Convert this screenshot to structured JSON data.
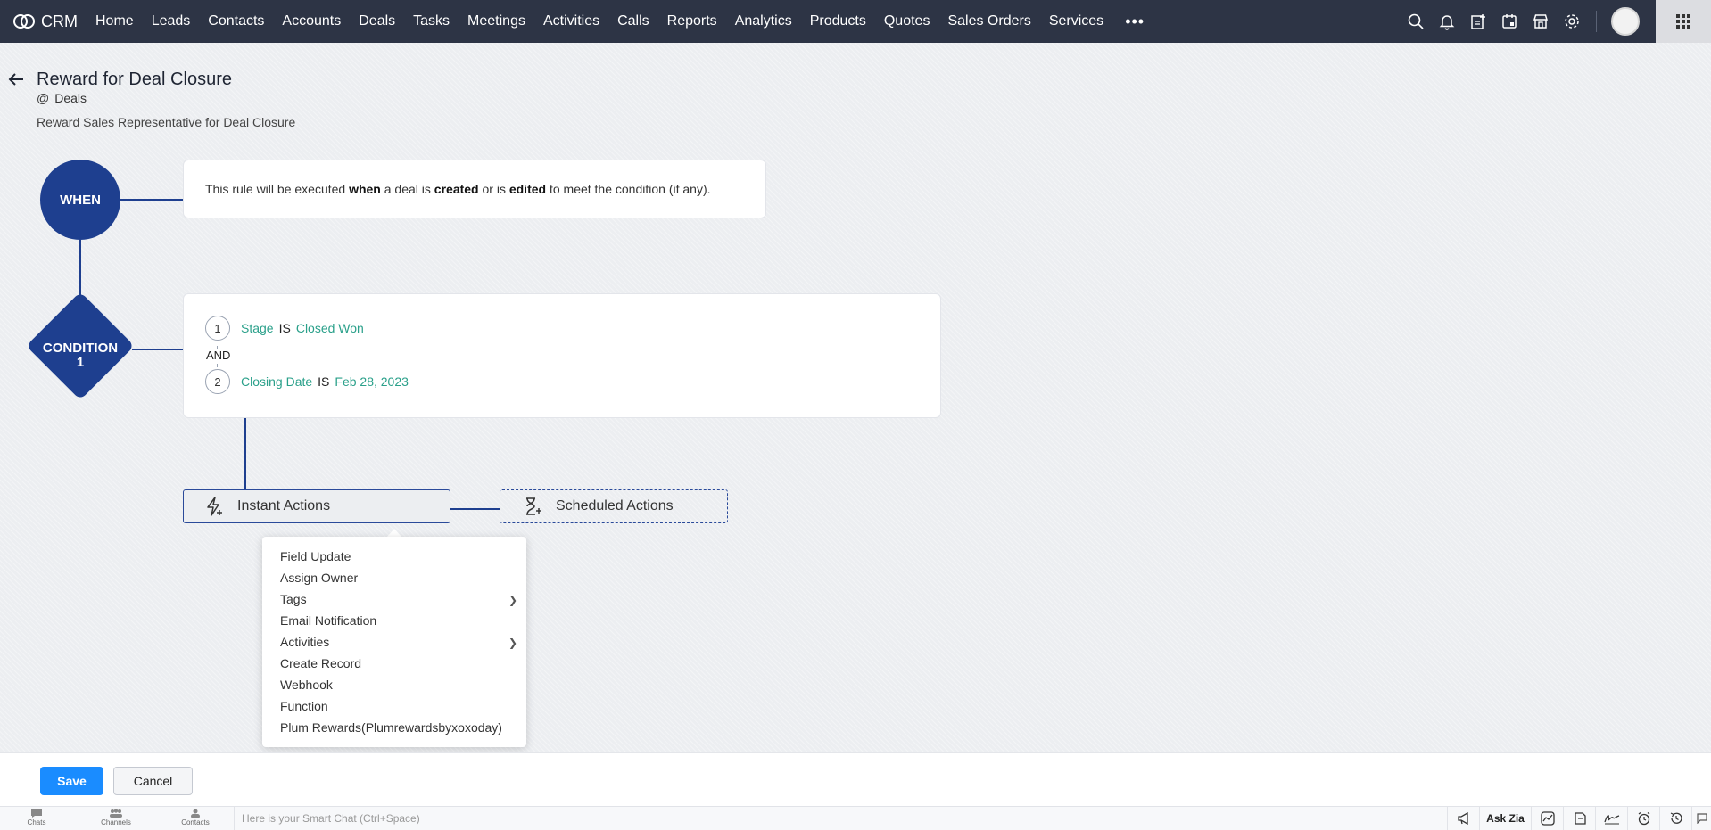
{
  "nav": {
    "brand": "CRM",
    "items": [
      "Home",
      "Leads",
      "Contacts",
      "Accounts",
      "Deals",
      "Tasks",
      "Meetings",
      "Activities",
      "Calls",
      "Reports",
      "Analytics",
      "Products",
      "Quotes",
      "Sales Orders",
      "Services"
    ],
    "more": "•••"
  },
  "rule": {
    "title": "Reward for Deal Closure",
    "module_prefix": "@",
    "module": "Deals",
    "description": "Reward Sales Representative for Deal Closure"
  },
  "when": {
    "label": "WHEN",
    "text_1": "This rule will be executed ",
    "bold_1": "when",
    "text_2": " a deal is ",
    "bold_2": "created",
    "text_3": " or is ",
    "bold_3": "edited",
    "text_4": " to meet the condition (if any)."
  },
  "condition": {
    "label_line1": "CONDITION",
    "label_line2": "1",
    "joiner": "AND",
    "criteria": [
      {
        "num": "1",
        "field": "Stage",
        "op": "IS",
        "value": "Closed Won"
      },
      {
        "num": "2",
        "field": "Closing Date",
        "op": "IS",
        "value": "Feb 28, 2023"
      }
    ]
  },
  "actions": {
    "instant": "Instant Actions",
    "scheduled": "Scheduled Actions",
    "menu": [
      {
        "label": "Field Update",
        "submenu": false
      },
      {
        "label": "Assign Owner",
        "submenu": false
      },
      {
        "label": "Tags",
        "submenu": true
      },
      {
        "label": "Email Notification",
        "submenu": false
      },
      {
        "label": "Activities",
        "submenu": true
      },
      {
        "label": "Create Record",
        "submenu": false
      },
      {
        "label": "Webhook",
        "submenu": false
      },
      {
        "label": "Function",
        "submenu": false
      },
      {
        "label": "Plum Rewards(Plumrewardsbyxoxoday)",
        "submenu": false
      }
    ]
  },
  "footer": {
    "save": "Save",
    "cancel": "Cancel"
  },
  "bottombar": {
    "tabs": [
      "Chats",
      "Channels",
      "Contacts"
    ],
    "smart_chat": "Here is your Smart Chat (Ctrl+Space)",
    "ask_zia": "Ask Zia"
  },
  "colors": {
    "nav_bg": "#2d3445",
    "flow_blue": "#1e3f8f",
    "value_green": "#2aa08a",
    "save_blue": "#1a8cff"
  }
}
